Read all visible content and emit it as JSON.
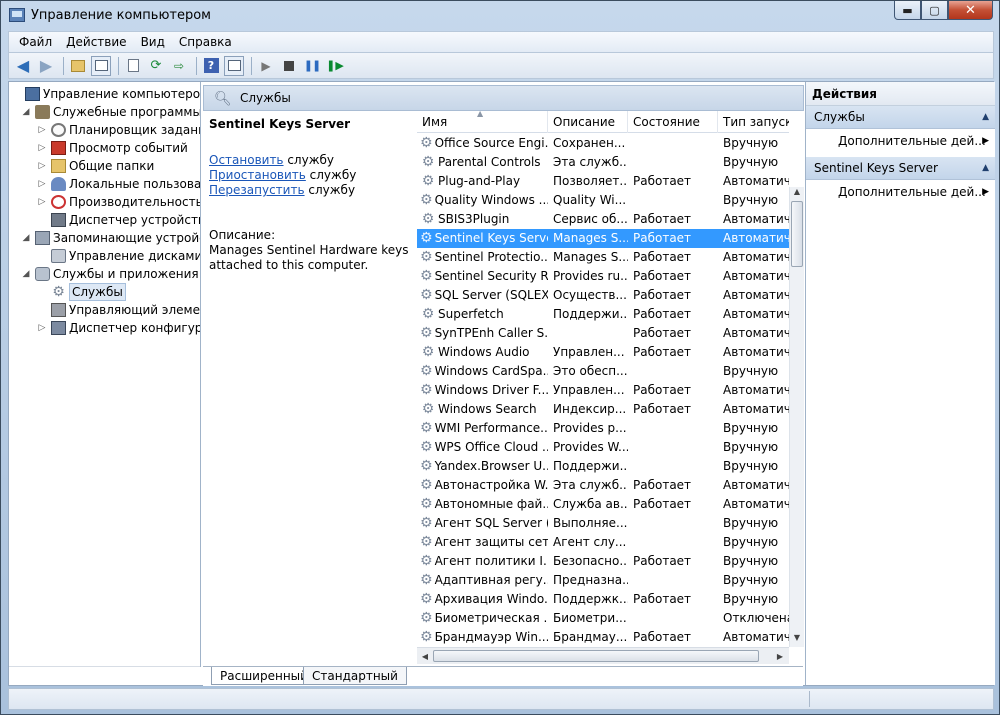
{
  "window": {
    "title": "Управление компьютером",
    "minimize": "▬",
    "maximize": "▢",
    "close": "✕"
  },
  "menu": [
    {
      "label": "Файл"
    },
    {
      "label": "Действие"
    },
    {
      "label": "Вид"
    },
    {
      "label": "Справка"
    }
  ],
  "tree": [
    {
      "label": "Управление компьютером (л",
      "level": 0,
      "expander": "",
      "icon": "computer-icon"
    },
    {
      "label": "Служебные программы",
      "level": 1,
      "expander": "◢",
      "icon": "tools-icon"
    },
    {
      "label": "Планировщик заданий",
      "level": 2,
      "expander": "▷",
      "icon": "clock-icon"
    },
    {
      "label": "Просмотр событий",
      "level": 2,
      "expander": "▷",
      "icon": "event-log-icon"
    },
    {
      "label": "Общие папки",
      "level": 2,
      "expander": "▷",
      "icon": "shared-folder-icon"
    },
    {
      "label": "Локальные пользовате",
      "level": 2,
      "expander": "▷",
      "icon": "users-icon"
    },
    {
      "label": "Производительность",
      "level": 2,
      "expander": "▷",
      "icon": "performance-icon"
    },
    {
      "label": "Диспетчер устройств",
      "level": 2,
      "expander": "",
      "icon": "device-manager-icon"
    },
    {
      "label": "Запоминающие устройст",
      "level": 1,
      "expander": "◢",
      "icon": "storage-icon"
    },
    {
      "label": "Управление дисками",
      "level": 2,
      "expander": "",
      "icon": "disk-icon"
    },
    {
      "label": "Службы и приложения",
      "level": 1,
      "expander": "◢",
      "icon": "services-apps-icon"
    },
    {
      "label": "Службы",
      "level": 2,
      "expander": "",
      "icon": "gear-icon",
      "selected": true
    },
    {
      "label": "Управляющий элемен",
      "level": 2,
      "expander": "",
      "icon": "wmi-icon"
    },
    {
      "label": "Диспетчер конфигурац",
      "level": 2,
      "expander": "▷",
      "icon": "config-manager-icon"
    }
  ],
  "services_header": "Службы",
  "details": {
    "title": "Sentinel Keys Server",
    "links": [
      {
        "link": "Остановить",
        "suffix": " службу"
      },
      {
        "link": "Приостановить",
        "suffix": " службу"
      },
      {
        "link": "Перезапустить",
        "suffix": " службу"
      }
    ],
    "desc_label": "Описание:",
    "desc_text": "Manages Sentinel Hardware keys attached to this computer."
  },
  "columns": {
    "name": "Имя",
    "description": "Описание",
    "state": "Состояние",
    "startup": "Тип запуск"
  },
  "services": [
    {
      "name": "Office Source Engi...",
      "description": "Сохранен...",
      "state": "",
      "startup": "Вручную"
    },
    {
      "name": "Parental Controls",
      "description": "Эта служб...",
      "state": "",
      "startup": "Вручную"
    },
    {
      "name": "Plug-and-Play",
      "description": "Позволяет...",
      "state": "Работает",
      "startup": "Автоматич"
    },
    {
      "name": "Quality Windows ...",
      "description": "Quality Wi...",
      "state": "",
      "startup": "Вручную"
    },
    {
      "name": "SBIS3Plugin",
      "description": "Сервис об...",
      "state": "Работает",
      "startup": "Автоматич"
    },
    {
      "name": "Sentinel Keys Server",
      "description": "Manages S...",
      "state": "Работает",
      "startup": "Автоматич",
      "selected": true
    },
    {
      "name": "Sentinel Protectio...",
      "description": "Manages S...",
      "state": "Работает",
      "startup": "Автоматич"
    },
    {
      "name": "Sentinel Security R...",
      "description": "Provides ru...",
      "state": "Работает",
      "startup": "Автоматич"
    },
    {
      "name": "SQL Server (SQLEX...",
      "description": "Осуществ...",
      "state": "Работает",
      "startup": "Автоматич"
    },
    {
      "name": "Superfetch",
      "description": "Поддержи...",
      "state": "Работает",
      "startup": "Автоматич"
    },
    {
      "name": "SynTPEnh Caller S...",
      "description": "",
      "state": "Работает",
      "startup": "Автоматич"
    },
    {
      "name": "Windows Audio",
      "description": "Управлен...",
      "state": "Работает",
      "startup": "Автоматич"
    },
    {
      "name": "Windows CardSpa...",
      "description": "Это обесп...",
      "state": "",
      "startup": "Вручную"
    },
    {
      "name": "Windows Driver F...",
      "description": "Управлен...",
      "state": "Работает",
      "startup": "Автоматич"
    },
    {
      "name": "Windows Search",
      "description": "Индексир...",
      "state": "Работает",
      "startup": "Автоматич"
    },
    {
      "name": "WMI Performance...",
      "description": "Provides p...",
      "state": "",
      "startup": "Вручную"
    },
    {
      "name": "WPS Office Cloud ...",
      "description": "Provides W...",
      "state": "",
      "startup": "Вручную"
    },
    {
      "name": "Yandex.Browser U...",
      "description": "Поддержи...",
      "state": "",
      "startup": "Вручную"
    },
    {
      "name": "Автонастройка W...",
      "description": "Эта служб...",
      "state": "Работает",
      "startup": "Автоматич"
    },
    {
      "name": "Автономные фай...",
      "description": "Служба ав...",
      "state": "Работает",
      "startup": "Автоматич"
    },
    {
      "name": "Агент SQL Server (...",
      "description": "Выполняе...",
      "state": "",
      "startup": "Вручную"
    },
    {
      "name": "Агент защиты сет...",
      "description": "Агент слу...",
      "state": "",
      "startup": "Вручную"
    },
    {
      "name": "Агент политики I...",
      "description": "Безопасно...",
      "state": "Работает",
      "startup": "Вручную"
    },
    {
      "name": "Адаптивная регу...",
      "description": "Предназна...",
      "state": "",
      "startup": "Вручную"
    },
    {
      "name": "Архивация Windo...",
      "description": "Поддержк...",
      "state": "Работает",
      "startup": "Вручную"
    },
    {
      "name": "Биометрическая ...",
      "description": "Биометри...",
      "state": "",
      "startup": "Отключена"
    },
    {
      "name": "Брандмауэр Win...",
      "description": "Брандмау...",
      "state": "Работает",
      "startup": "Автоматич"
    }
  ],
  "tabs": [
    {
      "label": "Расширенный",
      "active": true
    },
    {
      "label": "Стандартный",
      "active": false
    }
  ],
  "actions": {
    "title": "Действия",
    "sections": [
      {
        "title": "Службы",
        "item": "Дополнительные дей..."
      },
      {
        "title": "Sentinel Keys Server",
        "item": "Дополнительные дей..."
      }
    ]
  },
  "icons": {
    "back": "back-arrow-icon",
    "forward": "forward-arrow-icon",
    "play": "start-service-icon",
    "stop": "stop-service-icon",
    "pause": "pause-service-icon",
    "resume": "restart-service-icon"
  },
  "colors": {
    "selection": "#3399ff",
    "link": "#1a56b8",
    "section_header": "#c3d5ea"
  }
}
